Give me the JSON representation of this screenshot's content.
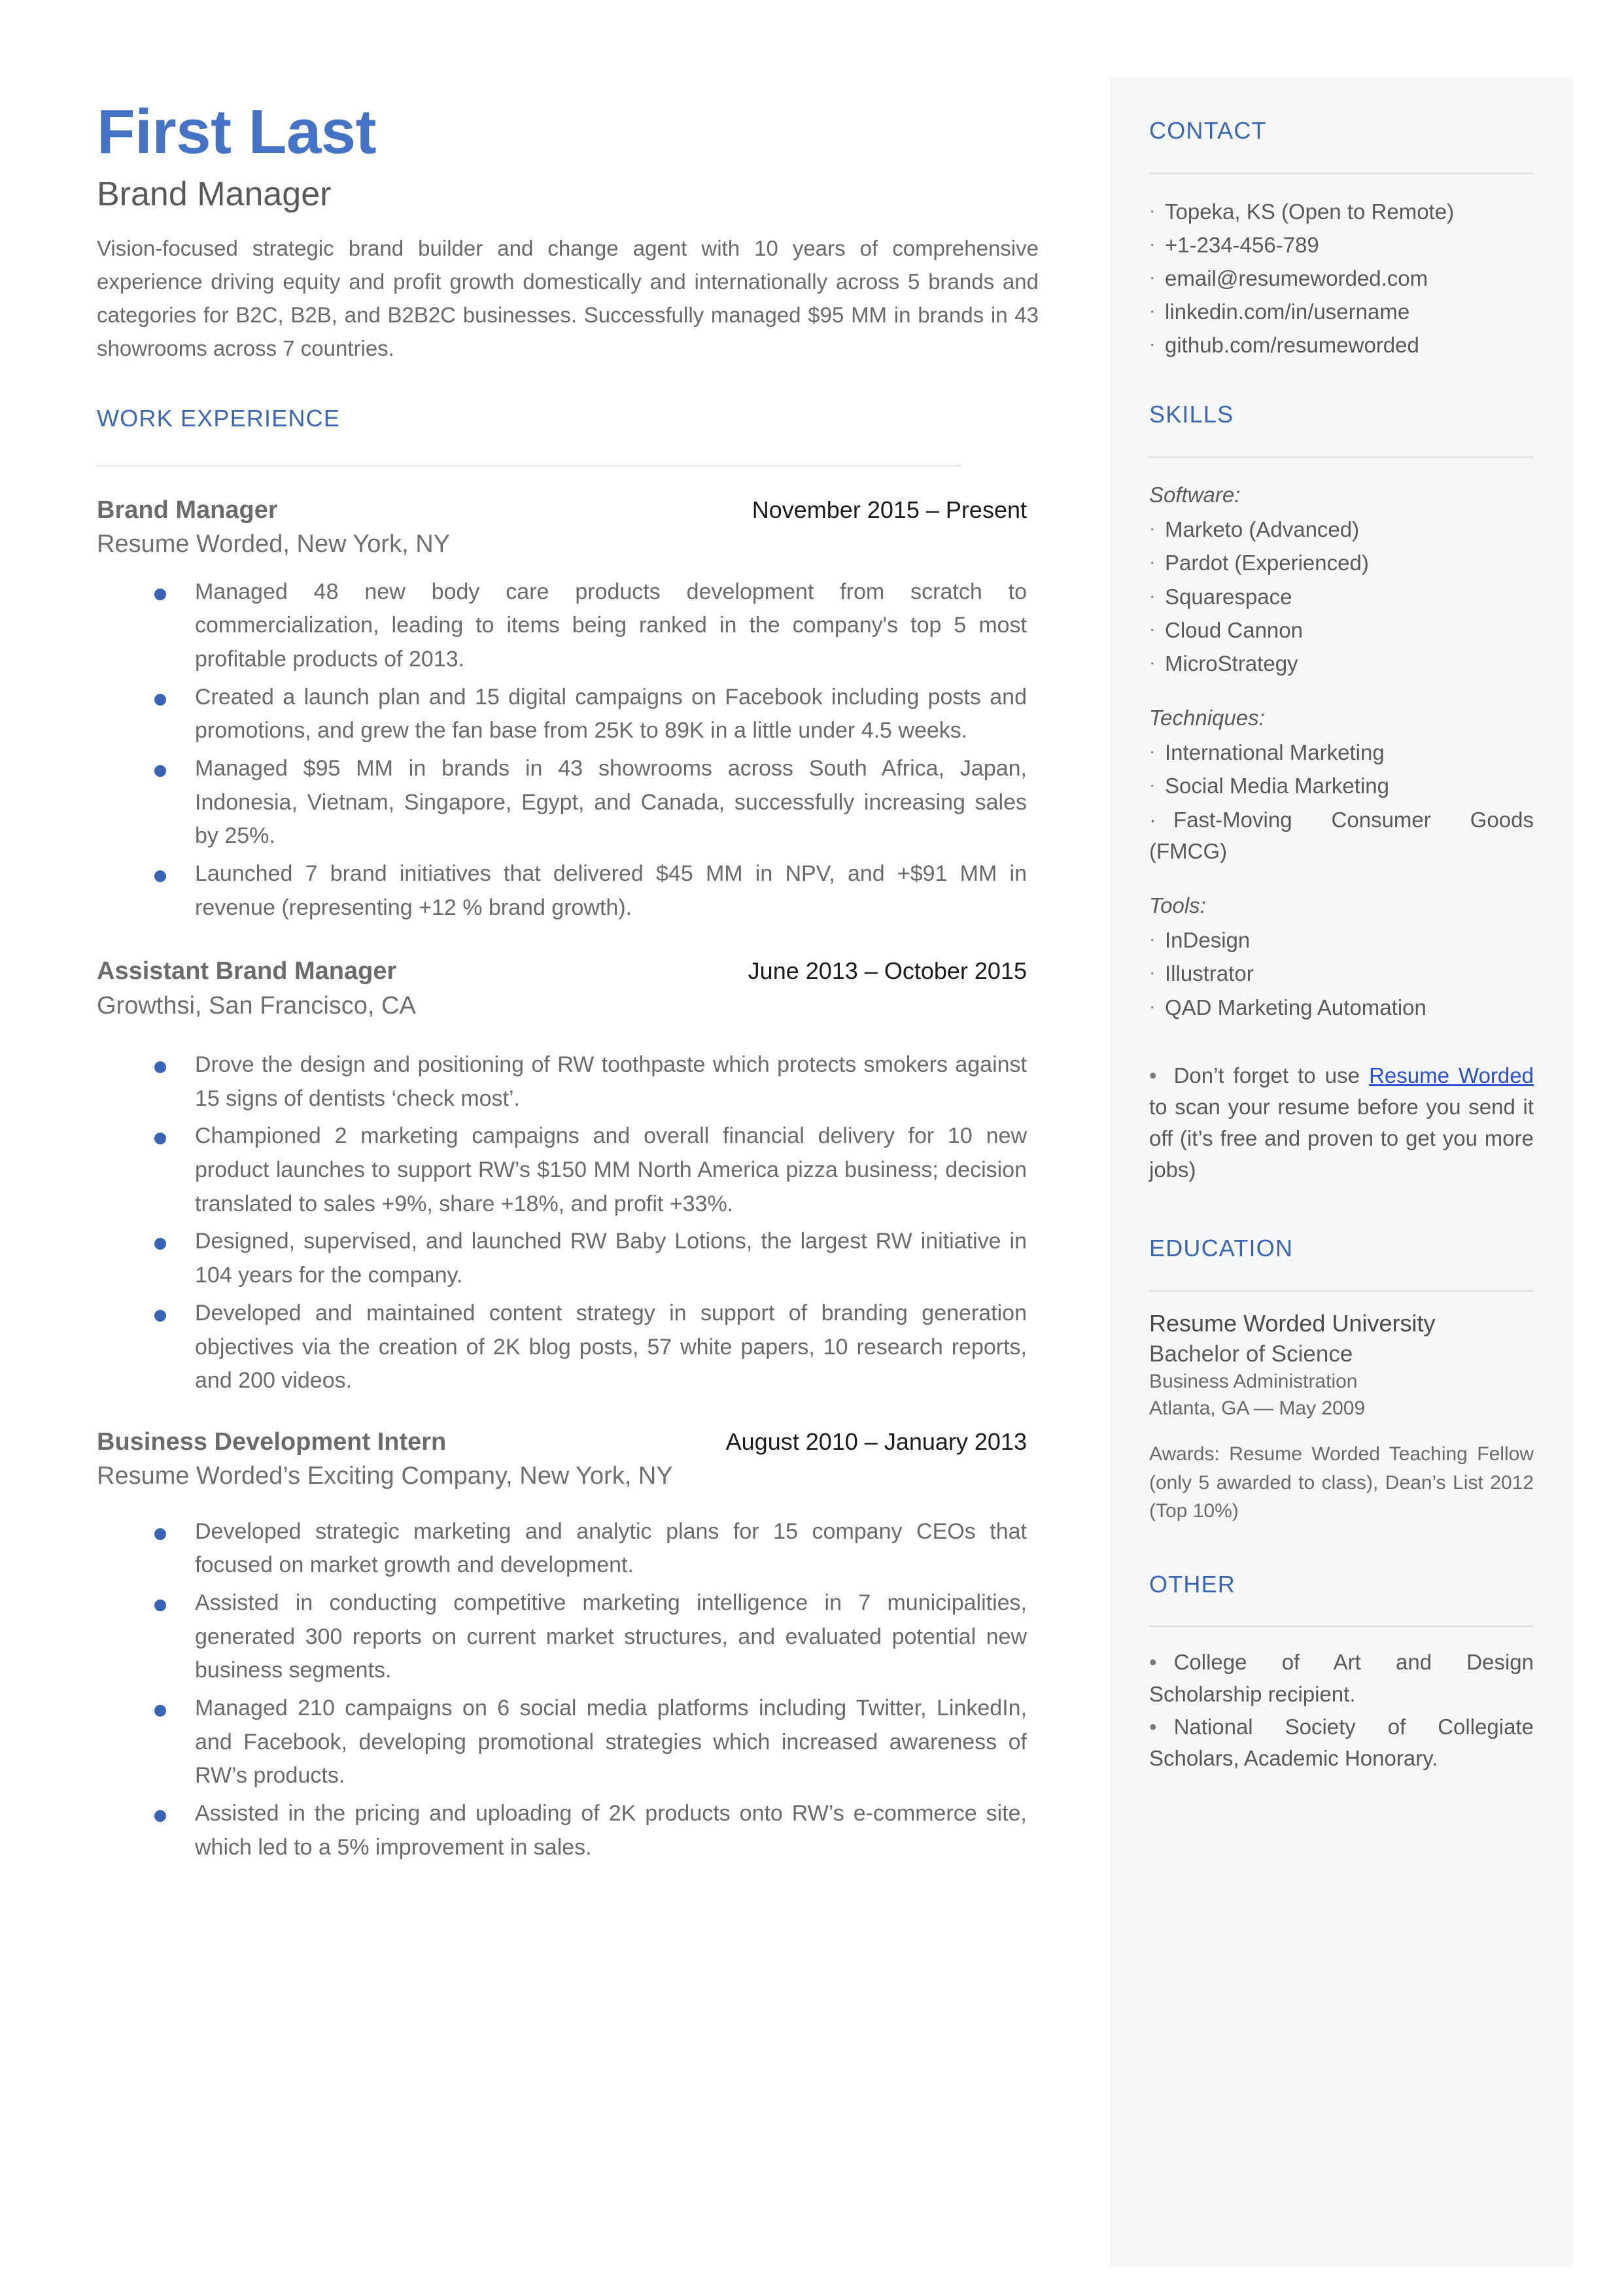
{
  "theme": {
    "accent_blue": "#4472C4",
    "heading_blue": "#3A66B5",
    "link_blue": "#2B4FD0",
    "body_gray": "#6A6A6A",
    "sidebar_bg": "#F4F6F8"
  },
  "header": {
    "name": "First Last",
    "role": "Brand Manager",
    "summary": "Vision-focused strategic brand builder and change agent with 10 years of comprehensive experience driving equity and profit growth domestically and internationally across 5 brands and categories for B2C, B2B, and B2B2C businesses. Successfully managed $95 MM in brands in 43 showrooms across 7 countries."
  },
  "work_experience": {
    "heading": "WORK EXPERIENCE",
    "jobs": [
      {
        "title": "Brand Manager",
        "dates": "November 2015 – Present",
        "company": "Resume Worded, New York, NY",
        "bullets": [
          "Managed 48 new body care products development from scratch to commercialization, leading to items being ranked in the company's top 5 most profitable products of 2013.",
          "Created a launch plan and 15 digital campaigns on Facebook including posts and promotions, and grew the fan base from 25K to 89K in a little under 4.5 weeks.",
          "Managed $95 MM in brands in 43 showrooms across South Africa, Japan, Indonesia, Vietnam, Singapore, Egypt, and Canada, successfully increasing sales by 25%.",
          "Launched 7 brand initiatives that delivered $45 MM in NPV, and +$91 MM in revenue (representing +12 % brand growth)."
        ]
      },
      {
        "title": "Assistant Brand Manager",
        "dates": "June 2013 – October 2015",
        "company": "Growthsi, San Francisco, CA",
        "bullets": [
          "Drove the design and positioning of RW toothpaste which protects smokers against 15 signs of dentists ‘check most’.",
          "Championed 2 marketing campaigns and overall financial delivery for 10 new product launches to support RW’s $150 MM North America pizza business; decision translated to sales +9%, share +18%, and profit +33%.",
          "Designed, supervised, and launched RW Baby Lotions, the largest RW initiative in 104 years for the company.",
          "Developed and maintained content strategy in support of branding generation objectives via the creation of 2K blog posts, 57 white papers, 10 research reports, and 200 videos."
        ]
      },
      {
        "title": "Business Development Intern",
        "dates": "August 2010 – January 2013",
        "company": "Resume Worded’s Exciting Company, New York, NY",
        "bullets": [
          "Developed strategic marketing and analytic plans for 15 company CEOs that focused on market growth and development.",
          "Assisted in conducting competitive marketing intelligence in 7 municipalities, generated 300 reports on current market structures, and evaluated potential new business segments.",
          "Managed 210 campaigns on 6 social media platforms including Twitter, LinkedIn, and Facebook, developing promotional strategies which increased awareness of RW’s products.",
          "Assisted in the pricing and uploading of 2K products onto RW’s e-commerce site, which led to a 5% improvement in sales."
        ]
      }
    ]
  },
  "sidebar": {
    "contact": {
      "heading": "CONTACT",
      "items": [
        "Topeka, KS (Open to Remote)",
        "+1-234-456-789",
        "email@resumeworded.com",
        "linkedin.com/in/username",
        "github.com/resumeworded"
      ]
    },
    "skills": {
      "heading": "SKILLS",
      "groups": [
        {
          "label": "Software:",
          "items": [
            "Marketo (Advanced)",
            "Pardot (Experienced)",
            "Squarespace",
            "Cloud Cannon",
            "MicroStrategy"
          ]
        },
        {
          "label": "Techniques:",
          "items": [
            "International Marketing",
            "Social Media Marketing",
            "Fast-Moving Consumer Goods (FMCG)"
          ]
        },
        {
          "label": "Tools:",
          "items": [
            "InDesign",
            "Illustrator",
            "QAD Marketing Automation"
          ]
        }
      ],
      "promo": {
        "bullet": "•",
        "before_link": "Don’t forget to use ",
        "link_text": "Resume Worded",
        "after_link": " to scan your resume before you send it off (it’s free and proven to get you more jobs)"
      }
    },
    "education": {
      "heading": "EDUCATION",
      "school": "Resume Worded University",
      "degree": "Bachelor of Science",
      "field": "Business Administration",
      "place_date": "Atlanta, GA — May 2009",
      "awards": "Awards: Resume Worded Teaching Fellow (only 5 awarded to class), Dean’s List 2012 (Top 10%)"
    },
    "other": {
      "heading": "OTHER",
      "items": [
        "College of Art and Design Scholarship recipient.",
        "National Society of Collegiate Scholars, Academic Honorary."
      ]
    }
  }
}
